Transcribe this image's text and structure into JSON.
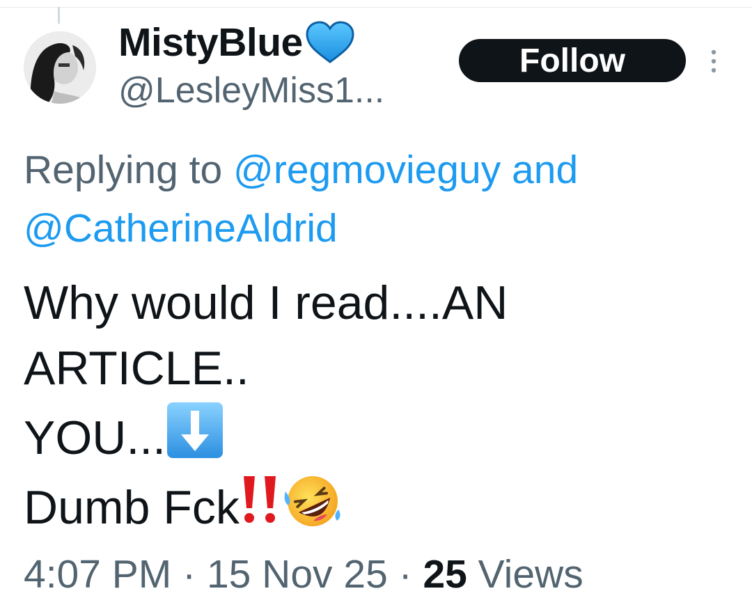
{
  "author": {
    "display_name": "MistyBlue",
    "verified_emoji": "blue-heart",
    "handle": "@LesleyMiss1..."
  },
  "actions": {
    "follow_label": "Follow",
    "more_icon": "vertical-ellipsis-icon"
  },
  "reply_context": {
    "prefix": "Replying to ",
    "mention_1": "@regmovieguy",
    "conjunction": " and",
    "mention_2": "@CatherineAldrid"
  },
  "tweet": {
    "line_1": "Why would I read....AN",
    "line_2": "ARTICLE..",
    "line_3": "YOU...",
    "line_3_emoji": "down-arrow-emoji",
    "line_4": "Dumb Fck",
    "line_4_emojis": [
      "double-exclamation-emoji",
      "rolling-laughing-emoji"
    ]
  },
  "meta": {
    "time": "4:07 PM",
    "separator": " · ",
    "date": "15 Nov 25",
    "views_count": "25",
    "views_label": " Views"
  },
  "colors": {
    "text": "#0f1419",
    "secondary": "#536471",
    "link": "#1d9bf0",
    "follow_bg": "#0f1419"
  }
}
